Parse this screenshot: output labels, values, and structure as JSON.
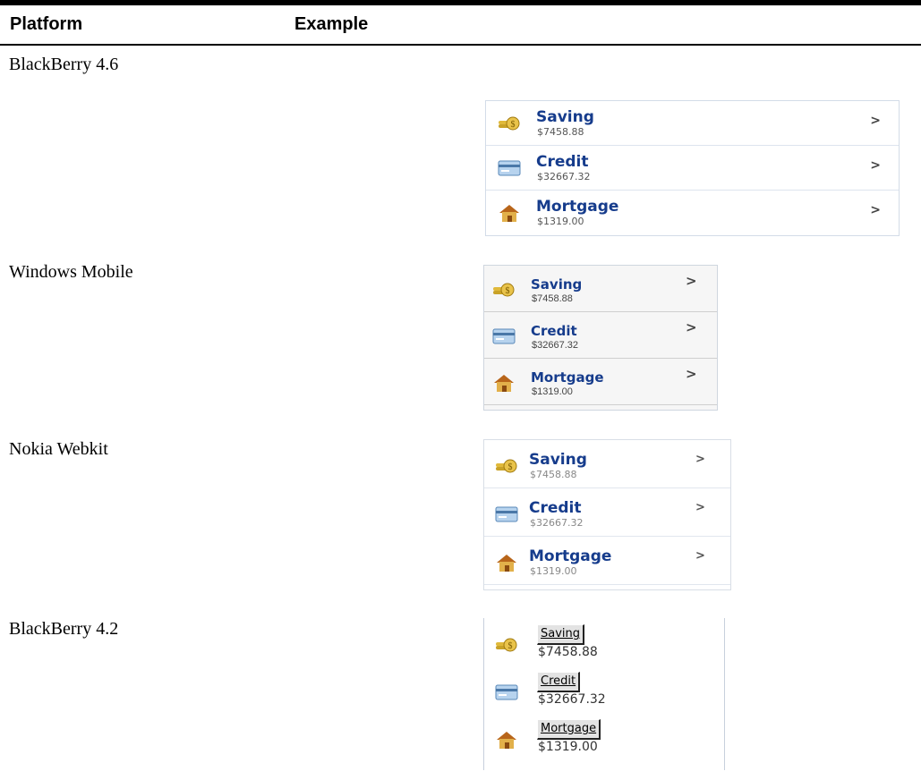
{
  "headers": {
    "platform": "Platform",
    "example": "Example"
  },
  "platforms": [
    {
      "name": "BlackBerry 4.6",
      "chevron": ">",
      "rows": [
        {
          "icon": "coins-icon",
          "title": "Saving",
          "amount": "$7458.88"
        },
        {
          "icon": "credit-card-icon",
          "title": "Credit",
          "amount": "$32667.32"
        },
        {
          "icon": "house-icon",
          "title": "Mortgage",
          "amount": "$1319.00"
        }
      ]
    },
    {
      "name": "Windows Mobile",
      "chevron": ">",
      "rows": [
        {
          "icon": "coins-icon",
          "title": "Saving",
          "amount": "$7458.88"
        },
        {
          "icon": "credit-card-icon",
          "title": "Credit",
          "amount": "$32667.32"
        },
        {
          "icon": "house-icon",
          "title": "Mortgage",
          "amount": "$1319.00"
        }
      ]
    },
    {
      "name": "Nokia Webkit",
      "chevron": ">",
      "rows": [
        {
          "icon": "coins-icon",
          "title": "Saving",
          "amount": "$7458.88"
        },
        {
          "icon": "credit-card-icon",
          "title": "Credit",
          "amount": "$32667.32"
        },
        {
          "icon": "house-icon",
          "title": "Mortgage",
          "amount": "$1319.00"
        }
      ]
    },
    {
      "name": "BlackBerry 4.2",
      "rows": [
        {
          "icon": "coins-icon",
          "title": "Saving",
          "amount": "$7458.88"
        },
        {
          "icon": "credit-card-icon",
          "title": "Credit",
          "amount": "$32667.32"
        },
        {
          "icon": "house-icon",
          "title": "Mortgage",
          "amount": "$1319.00"
        }
      ]
    }
  ]
}
